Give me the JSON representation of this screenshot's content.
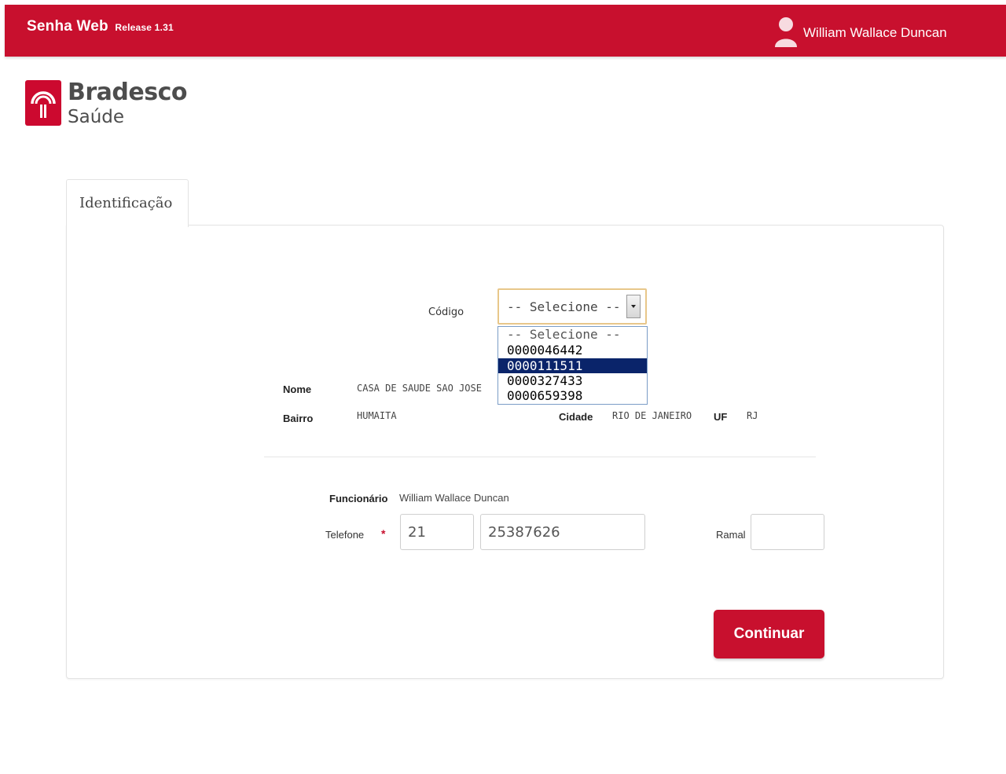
{
  "header": {
    "app_name": "Senha Web",
    "release": "Release 1.31",
    "user_name": "William Wallace Duncan"
  },
  "logo": {
    "brand": "Bradesco",
    "sub": "Saúde"
  },
  "tab": {
    "label": "Identificação"
  },
  "form": {
    "codigo": {
      "label": "Código",
      "selected": "-- Selecione --",
      "options": [
        "-- Selecione --",
        "0000046442",
        "0000111511",
        "0000327433",
        "0000659398"
      ],
      "highlighted_index": 2
    },
    "nome": {
      "label": "Nome",
      "value": "CASA DE SAUDE SAO JOSE"
    },
    "bairro": {
      "label": "Bairro",
      "value": "HUMAITA"
    },
    "cidade": {
      "label": "Cidade",
      "value": "RIO DE JANEIRO"
    },
    "uf": {
      "label": "UF",
      "value": "RJ"
    },
    "funcionario": {
      "label": "Funcionário",
      "value": "William Wallace Duncan"
    },
    "telefone": {
      "label": "Telefone",
      "required_mark": "*",
      "ddd": "21",
      "numero": "25387626"
    },
    "ramal": {
      "label": "Ramal",
      "value": ""
    },
    "submit_label": "Continuar"
  },
  "colors": {
    "brand_red": "#c8102e",
    "select_highlight": "#0a246a"
  }
}
